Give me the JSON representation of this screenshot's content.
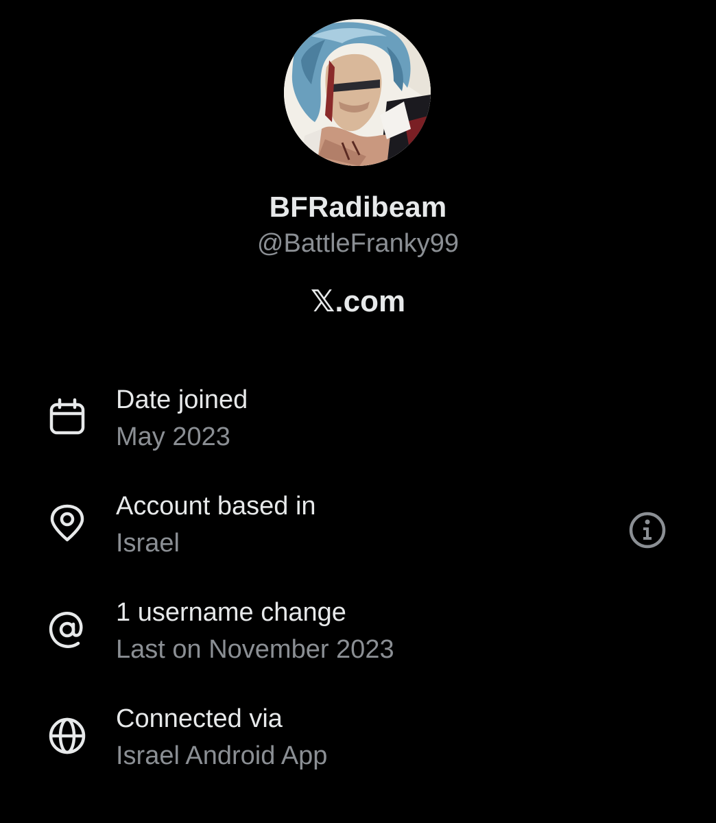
{
  "profile": {
    "display_name": "BFRadibeam",
    "handle": "@BattleFranky99",
    "site": "𝕏.com",
    "avatar_icon": "profile-avatar-illustration"
  },
  "about": [
    {
      "icon": "calendar-icon",
      "label": "Date joined",
      "value": "May 2023"
    },
    {
      "icon": "location-pin-icon",
      "label": "Account based in",
      "value": "Israel",
      "action_icon": "info-icon"
    },
    {
      "icon": "at-sign-icon",
      "label": "1 username change",
      "value": "Last on November 2023"
    },
    {
      "icon": "globe-icon",
      "label": "Connected via",
      "value": "Israel Android App"
    }
  ],
  "colors": {
    "background": "#000000",
    "primary_text": "#e7e9ea",
    "secondary_text": "#8b8f94"
  }
}
